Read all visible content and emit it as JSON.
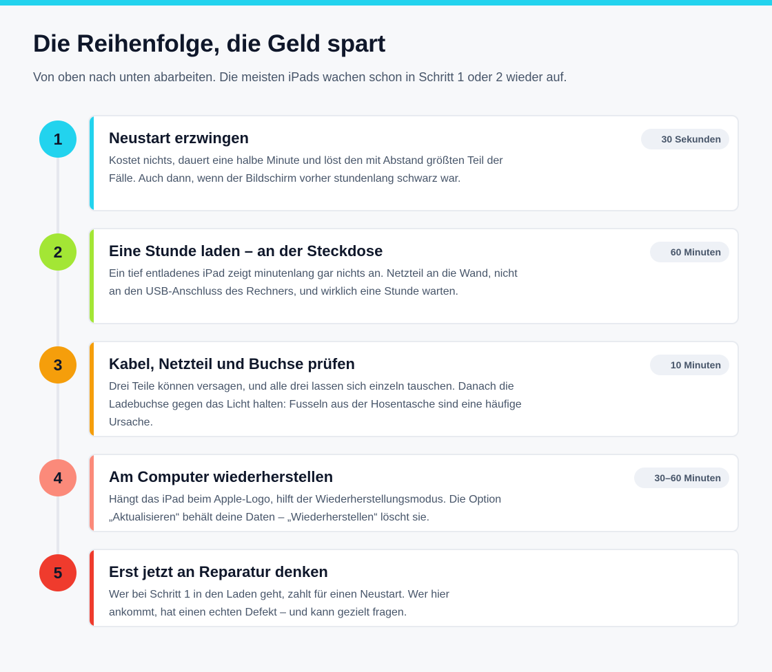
{
  "header": {
    "title": "Die Reihenfolge, die Geld spart",
    "subtitle": "Von oben nach unten abarbeiten. Die meisten iPads wachen schon in Schritt 1 oder 2 wieder auf."
  },
  "colors": {
    "topbar": "#22d3ee",
    "step1": "#22d3ee",
    "step2": "#a3e635",
    "step3": "#f59e0b",
    "step4": "#fb8a7a",
    "step5": "#ef3b2d"
  },
  "steps": [
    {
      "number": "1",
      "title": "Neustart erzwingen",
      "badge": "30 Sekunden",
      "description": "Kostet nichts, dauert eine halbe Minute und löst den mit Abstand größten Teil der Fälle. Auch dann, wenn der Bildschirm vorher stundenlang schwarz war."
    },
    {
      "number": "2",
      "title": "Eine Stunde laden – an der Steckdose",
      "badge": "60 Minuten",
      "description": "Ein tief entladenes iPad zeigt minutenlang gar nichts an. Netzteil an die Wand, nicht an den USB-Anschluss des Rechners, und wirklich eine Stunde warten."
    },
    {
      "number": "3",
      "title": "Kabel, Netzteil und Buchse prüfen",
      "badge": "10 Minuten",
      "description": "Drei Teile können versagen, und alle drei lassen sich einzeln tauschen. Danach die Ladebuchse gegen das Licht halten: Fusseln aus der Hosentasche sind eine häufige Ursache."
    },
    {
      "number": "4",
      "title": "Am Computer wiederherstellen",
      "badge": "30–60 Minuten",
      "description": "Hängt das iPad beim Apple-Logo, hilft der Wiederherstellungsmodus. Die Option „Aktualisieren“ behält deine Daten – „Wiederherstellen“ löscht sie."
    },
    {
      "number": "5",
      "title": "Erst jetzt an Reparatur denken",
      "description": "Wer bei Schritt 1 in den Laden geht, zahlt für einen Neustart. Wer hier ankommt, hat einen echten Defekt – und kann gezielt fragen."
    }
  ]
}
